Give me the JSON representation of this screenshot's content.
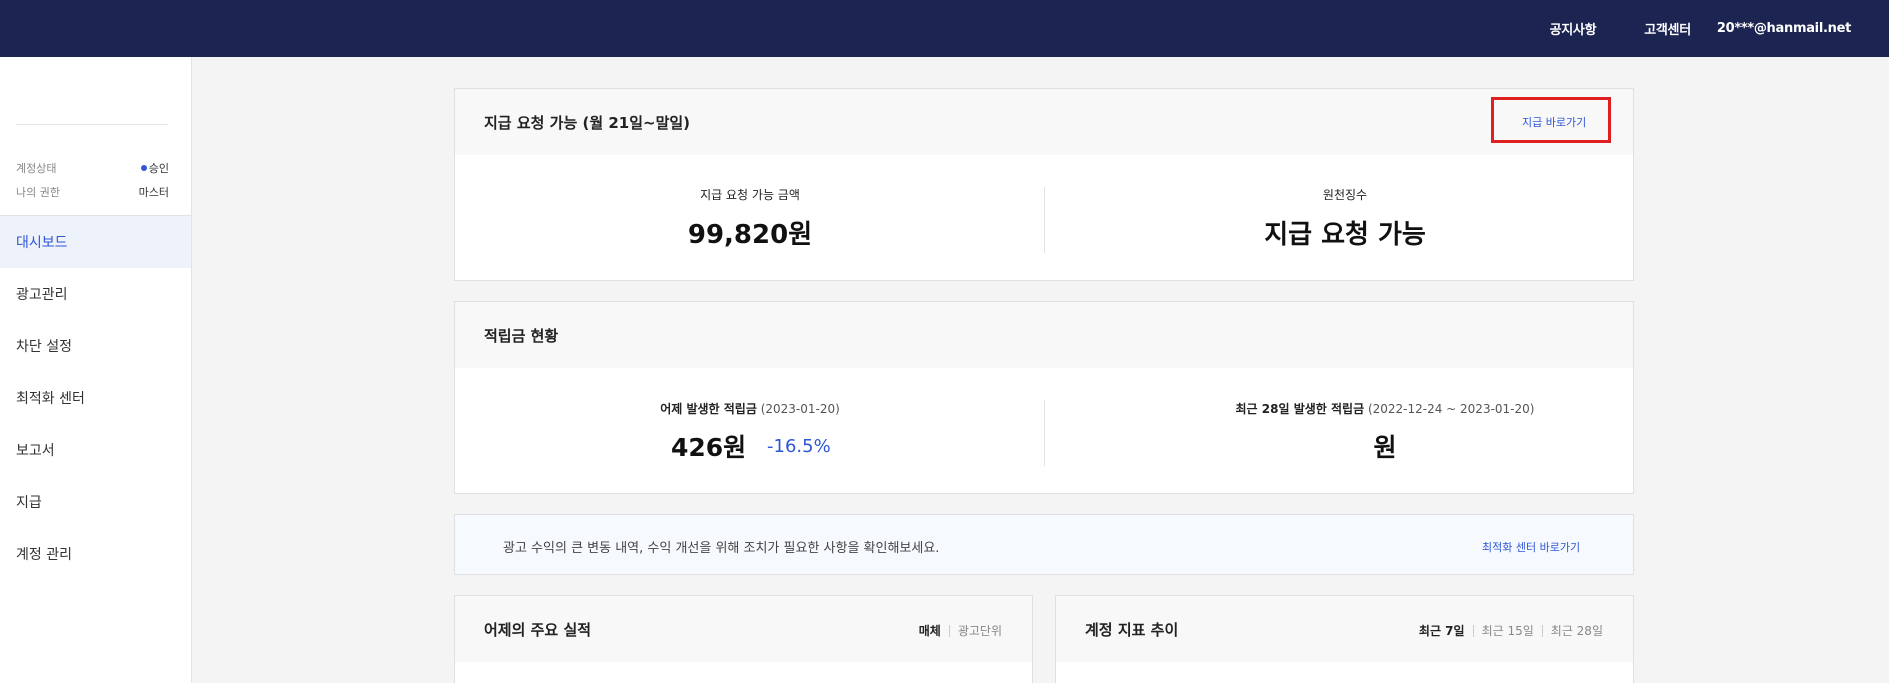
{
  "header": {
    "notice_label": "공지사항",
    "support_label": "고객센터",
    "account_email": "20***@hanmail.net"
  },
  "sidebar": {
    "account_status_label": "계정상태",
    "account_status_value": "승인",
    "permission_label": "나의 권한",
    "permission_value": "마스터",
    "items": [
      {
        "label": "대시보드"
      },
      {
        "label": "광고관리"
      },
      {
        "label": "차단 설정"
      },
      {
        "label": "최적화 센터"
      },
      {
        "label": "보고서"
      },
      {
        "label": "지급"
      },
      {
        "label": "계정 관리"
      }
    ]
  },
  "payment_card": {
    "title": "지급 요청 가능 (월 21일~말일)",
    "link_label": "지급 바로가기",
    "amount_label": "지급 요청 가능 금액",
    "amount_value": "99,820원",
    "tax_label": "원천징수",
    "tax_value": "지급 요청 가능"
  },
  "reward_card": {
    "title": "적립금 현황",
    "yesterday_label": "어제 발생한 적립금",
    "yesterday_date": "(2023-01-20)",
    "yesterday_value": "426원",
    "yesterday_change": "-16.5%",
    "recent_label": "최근 28일 발생한 적립금",
    "recent_range": "(2022-12-24 ~ 2023-01-20)",
    "recent_value": "원"
  },
  "notice_bar": {
    "message": "광고 수익의 큰 변동 내역, 수익 개선을 위해 조치가 필요한 사항을 확인해보세요.",
    "link_label": "최적화 센터 바로가기"
  },
  "performance_card": {
    "title": "어제의 주요 실적",
    "tabs": [
      "매체",
      "광고단위"
    ]
  },
  "trend_card": {
    "title": "계정 지표 추이",
    "tabs": [
      "최근 7일",
      "최근 15일",
      "최근 28일"
    ]
  },
  "colors": {
    "topbar": "#1c2452",
    "accent": "#2e57d6",
    "highlight": "#e02020"
  }
}
